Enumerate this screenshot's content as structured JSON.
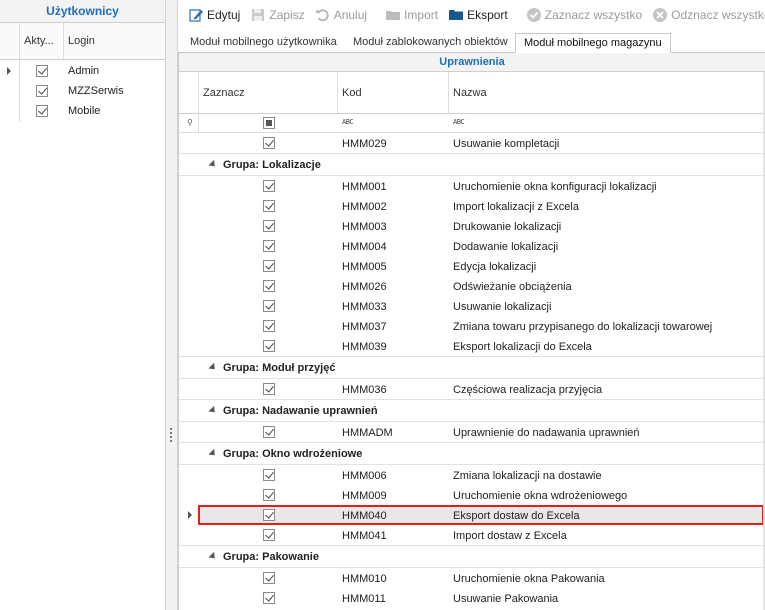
{
  "users_panel": {
    "title": "Użytkownicy",
    "columns": {
      "active": "Akty...",
      "login": "Login"
    },
    "rows": [
      {
        "active": true,
        "login": "Admin",
        "current": true
      },
      {
        "active": true,
        "login": "MZZSerwis",
        "current": false
      },
      {
        "active": true,
        "login": "Mobile",
        "current": false
      }
    ]
  },
  "toolbar": {
    "edit": "Edytuj",
    "save": "Zapisz",
    "cancel": "Anuluj",
    "import": "Import",
    "export": "Eksport",
    "select_all": "Zaznacz wszystko",
    "deselect_all": "Odznacz wszystko"
  },
  "tabs": [
    {
      "label": "Moduł mobilnego użytkownika",
      "active": false
    },
    {
      "label": "Moduł zablokowanych obiektów",
      "active": false
    },
    {
      "label": "Moduł mobilnego magazynu",
      "active": true
    }
  ],
  "permissions": {
    "band_title": "Uprawnienia",
    "columns": {
      "select": "Zaznacz",
      "code": "Kod",
      "name": "Nazwa"
    },
    "items": [
      {
        "type": "row",
        "checked": true,
        "code": "HMM029",
        "name": "Usuwanie kompletacji"
      },
      {
        "type": "group",
        "label": "Grupa: Lokalizacje"
      },
      {
        "type": "row",
        "checked": true,
        "code": "HMM001",
        "name": "Uruchomienie okna konfiguracji lokalizacji"
      },
      {
        "type": "row",
        "checked": true,
        "code": "HMM002",
        "name": "Import lokalizacji z Excela"
      },
      {
        "type": "row",
        "checked": true,
        "code": "HMM003",
        "name": "Drukowanie lokalizacji"
      },
      {
        "type": "row",
        "checked": true,
        "code": "HMM004",
        "name": "Dodawanie lokalizacji"
      },
      {
        "type": "row",
        "checked": true,
        "code": "HMM005",
        "name": "Edycja lokalizacji"
      },
      {
        "type": "row",
        "checked": true,
        "code": "HMM026",
        "name": "Odświeżanie obciążenia"
      },
      {
        "type": "row",
        "checked": true,
        "code": "HMM033",
        "name": "Usuwanie lokalizacji"
      },
      {
        "type": "row",
        "checked": true,
        "code": "HMM037",
        "name": "Zmiana towaru przypisanego do lokalizacji towarowej"
      },
      {
        "type": "row",
        "checked": true,
        "code": "HMM039",
        "name": "Eksport lokalizacji do Excela"
      },
      {
        "type": "group",
        "label": "Grupa: Moduł przyjęć"
      },
      {
        "type": "row",
        "checked": true,
        "code": "HMM036",
        "name": "Częściowa realizacja przyjęcia"
      },
      {
        "type": "group",
        "label": "Grupa: Nadawanie uprawnień"
      },
      {
        "type": "row",
        "checked": true,
        "code": "HMMADM",
        "name": "Uprawnienie do nadawania uprawnień"
      },
      {
        "type": "group",
        "label": "Grupa: Okno wdrożeniowe"
      },
      {
        "type": "row",
        "checked": true,
        "code": "HMM006",
        "name": "Zmiana lokalizacji na dostawie"
      },
      {
        "type": "row",
        "checked": true,
        "code": "HMM009",
        "name": "Uruchomienie okna wdrożeniowego"
      },
      {
        "type": "row",
        "checked": true,
        "code": "HMM040",
        "name": "Eksport dostaw do Excela",
        "selected": true
      },
      {
        "type": "row",
        "checked": true,
        "code": "HMM041",
        "name": "Import dostaw z Excela"
      },
      {
        "type": "group",
        "label": "Grupa: Pakowanie"
      },
      {
        "type": "row",
        "checked": true,
        "code": "HMM010",
        "name": "Uruchomienie okna Pakowania"
      },
      {
        "type": "row",
        "checked": true,
        "code": "HMM011",
        "name": "Usuwanie Pakowania"
      }
    ]
  },
  "colors": {
    "accent": "#1a6fb8",
    "selection_border": "#e0201a"
  }
}
